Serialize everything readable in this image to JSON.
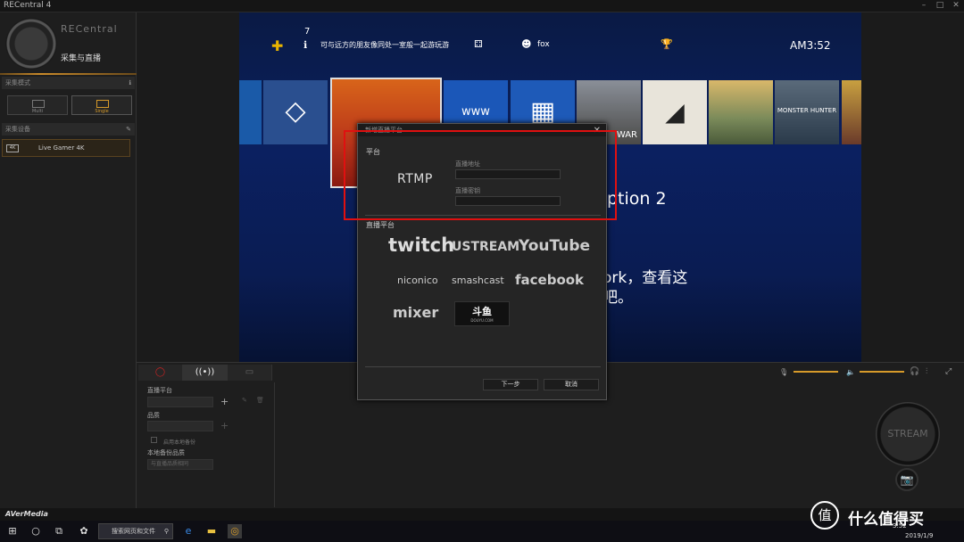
{
  "window": {
    "title": "RECentral 4"
  },
  "left": {
    "logo_text": "RECentral",
    "mode_label": "采集与直播",
    "capture_mode_header": "采集模式",
    "modes": [
      "Multi",
      "Single"
    ],
    "device_header": "采集设备",
    "device_name": "Live Gamer 4K",
    "device_icon_label": "4K"
  },
  "ps": {
    "notification_count": "7",
    "notification_text": "可与远方的朋友像同处一室般一起游玩游",
    "user": "fox",
    "time": "AM3:52",
    "tile_www": "www",
    "tile_war": "WAR",
    "tile_monster": "MONSTER HUNTER",
    "game_title_fragment": "ption 2",
    "body_fragment_1": "ork，查看这",
    "body_fragment_2": "吧。"
  },
  "lower": {
    "live_platform_label": "直播平台",
    "quality_label": "品质",
    "checkbox_label": "启用本地备份",
    "local_quality_label": "本地备份品质",
    "local_quality_value": "与直播品质相同",
    "stream_button": "STREAM"
  },
  "status": {
    "brand": "AVerMedia"
  },
  "taskbar": {
    "search_placeholder": "搜索网页和文件",
    "date": "2019/1/9",
    "time": "3:52"
  },
  "dialog": {
    "title": "新增直播平台",
    "platform_label": "平台",
    "rtmp_label": "RTMP",
    "url_label": "直播地址",
    "key_label": "直播密钥",
    "live_platforms_label": "直播平台",
    "platforms": [
      "twitch",
      "USTREAM",
      "YouTube",
      "niconico",
      "smashcast",
      "facebook",
      "mixer",
      "斗鱼"
    ],
    "douyu_sub": "DOUYU.COM",
    "next_button": "下一步",
    "cancel_button": "取消"
  },
  "watermark": {
    "circle": "值",
    "text": "什么值得买"
  },
  "colors": {
    "accent": "#d69a2a",
    "highlight": "#e01010",
    "ps_blue": "#0b2060"
  }
}
